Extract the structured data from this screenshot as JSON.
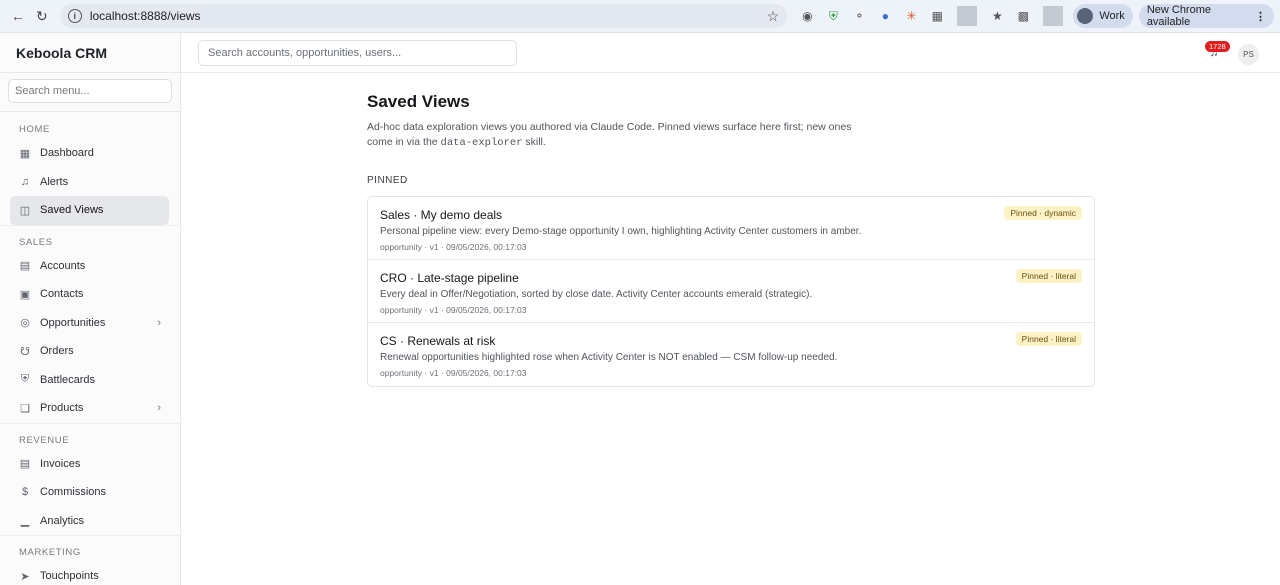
{
  "browser": {
    "url": "localhost:8888/views",
    "profile_label": "Work",
    "update_label": "New Chrome available"
  },
  "app": {
    "brand": "Keboola CRM",
    "menu_search_placeholder": "Search menu...",
    "global_search_placeholder": "Search accounts, opportunities, users...",
    "notification_count": "1728",
    "user_initials": "PS"
  },
  "sidebar": {
    "sections": [
      {
        "label": "HOME",
        "items": [
          {
            "label": "Dashboard",
            "icon": "dashboard-icon"
          },
          {
            "label": "Alerts",
            "icon": "bell-icon"
          },
          {
            "label": "Saved Views",
            "icon": "bookmark-icon",
            "active": true
          }
        ]
      },
      {
        "label": "SALES",
        "items": [
          {
            "label": "Accounts",
            "icon": "building-icon"
          },
          {
            "label": "Contacts",
            "icon": "contact-icon"
          },
          {
            "label": "Opportunities",
            "icon": "target-icon",
            "expandable": true
          },
          {
            "label": "Orders",
            "icon": "cart-icon"
          },
          {
            "label": "Battlecards",
            "icon": "shield-icon"
          },
          {
            "label": "Products",
            "icon": "box-icon",
            "expandable": true
          }
        ]
      },
      {
        "label": "REVENUE",
        "items": [
          {
            "label": "Invoices",
            "icon": "invoice-icon"
          },
          {
            "label": "Commissions",
            "icon": "dollar-icon"
          },
          {
            "label": "Analytics",
            "icon": "bar-chart-icon"
          }
        ]
      },
      {
        "label": "MARKETING",
        "items": [
          {
            "label": "Touchpoints",
            "icon": "send-icon"
          }
        ]
      }
    ]
  },
  "page": {
    "title": "Saved Views",
    "desc_before": "Ad-hoc data exploration views you authored via Claude Code. Pinned views surface here first; new ones come in via the ",
    "desc_code": "data-explorer",
    "desc_after": " skill.",
    "pinned_label": "PINNED",
    "views": [
      {
        "title": "Sales · My demo deals",
        "description": "Personal pipeline view: every Demo-stage opportunity I own, highlighting Activity Center customers in amber.",
        "meta": "opportunity · v1 · 09/05/2026, 00:17:03",
        "badge": "Pinned · dynamic"
      },
      {
        "title": "CRO · Late-stage pipeline",
        "description": "Every deal in Offer/Negotiation, sorted by close date. Activity Center accounts emerald (strategic).",
        "meta": "opportunity · v1 · 09/05/2026, 00:17:03",
        "badge": "Pinned · literal"
      },
      {
        "title": "CS · Renewals at risk",
        "description": "Renewal opportunities highlighted rose when Activity Center is NOT enabled — CSM follow-up needed.",
        "meta": "opportunity · v1 · 09/05/2026, 00:17:03",
        "badge": "Pinned · literal"
      }
    ]
  }
}
